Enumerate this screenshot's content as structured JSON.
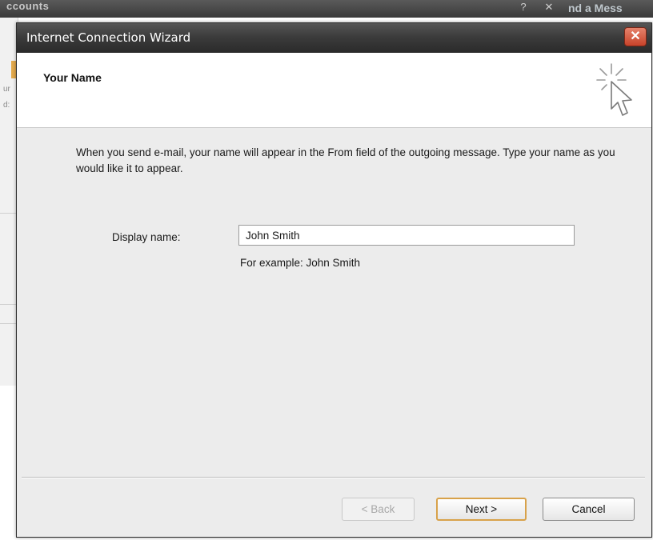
{
  "background": {
    "title_fragment": "ccounts",
    "right_fragment": "nd a Mess",
    "controls": [
      "?",
      "✕"
    ],
    "left_fragments": [
      "ur",
      "d:"
    ]
  },
  "wizard": {
    "title": "Internet Connection Wizard",
    "close_label": "✕",
    "header_title": "Your Name",
    "header_icon": "wizard-cursor-sparkle-icon",
    "intro_text": "When you send e-mail, your name will appear in the From field of the outgoing message. Type your name as you would like it to appear.",
    "display_name_label": "Display name:",
    "display_name_value": "John Smith",
    "example_text": "For example: John Smith",
    "buttons": {
      "back": "< Back",
      "next": "Next >",
      "cancel": "Cancel"
    }
  },
  "colors": {
    "close_button": "#d4573b",
    "default_button_border": "#d8a24a",
    "dialog_background": "#ececec"
  }
}
